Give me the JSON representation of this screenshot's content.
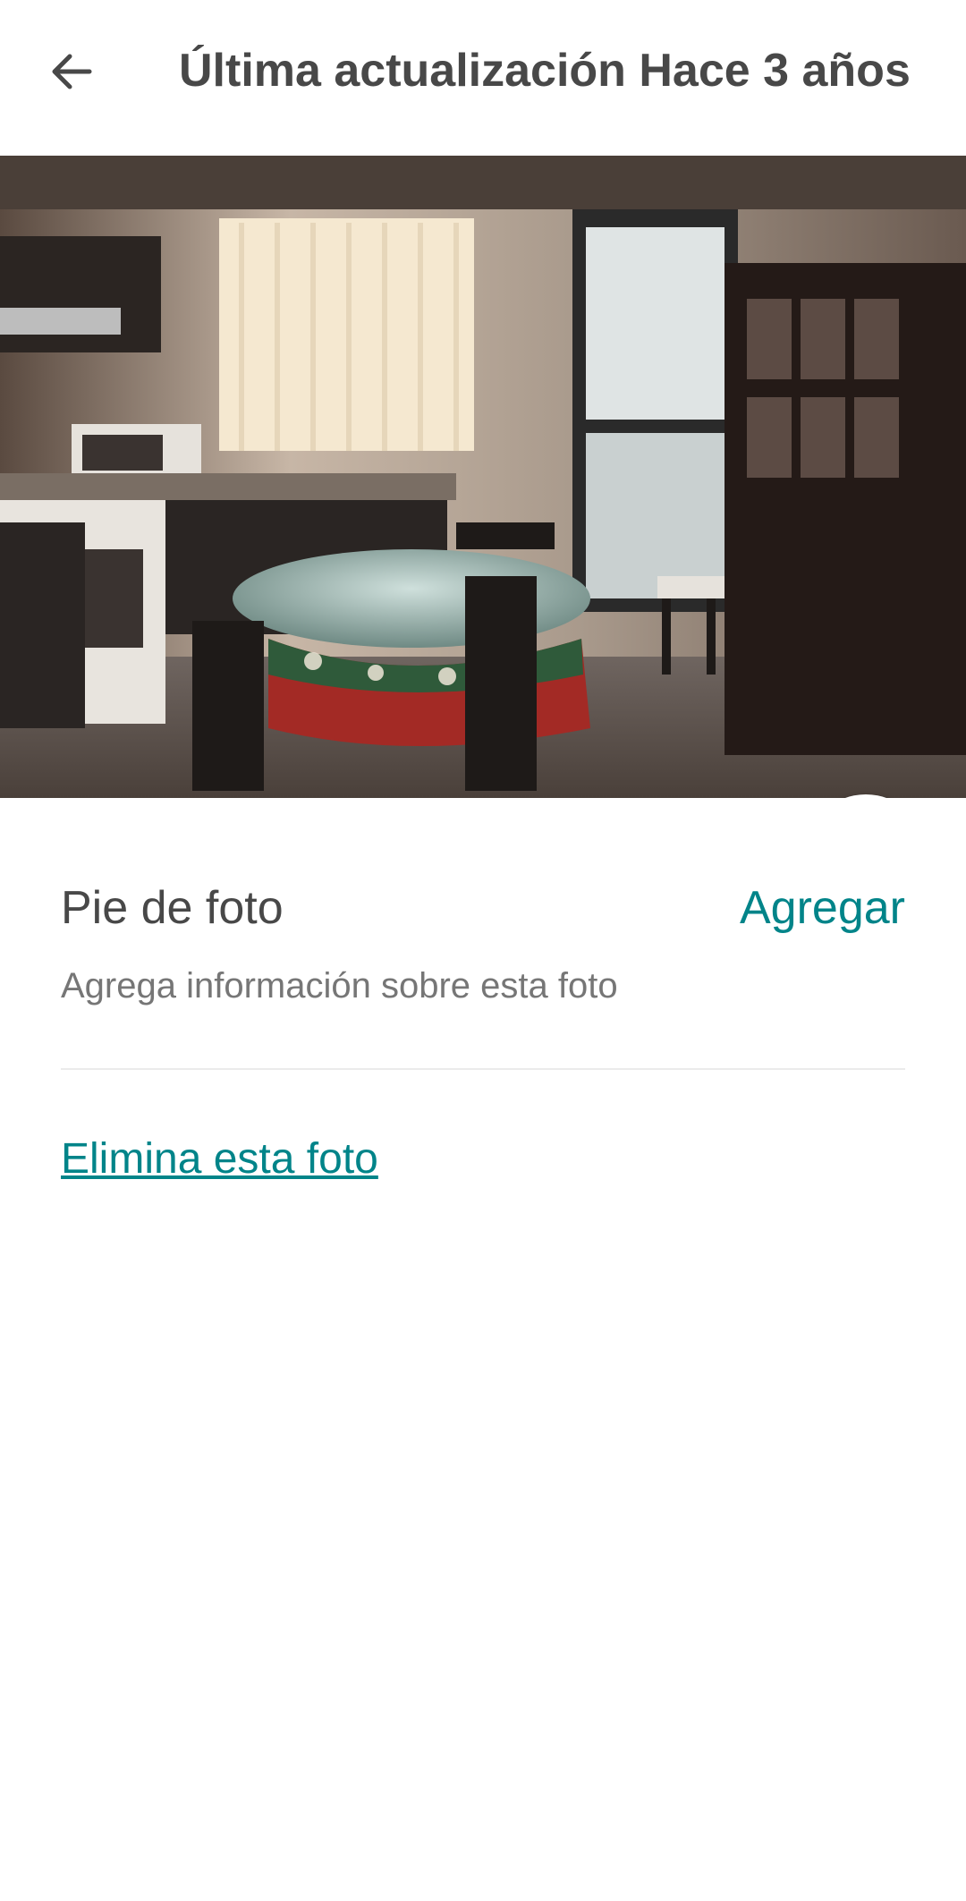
{
  "header": {
    "title": "Última actualización Hace 3 años",
    "back_icon": "arrow-left-icon"
  },
  "photo": {
    "edit_icon": "pencil-icon"
  },
  "caption": {
    "label": "Pie de foto",
    "action": "Agregar",
    "helper": "Agrega información sobre esta foto"
  },
  "delete": {
    "label": "Elimina esta foto"
  },
  "colors": {
    "accent": "#008489",
    "text": "#484848",
    "muted": "#767676",
    "divider": "#ebebeb"
  }
}
